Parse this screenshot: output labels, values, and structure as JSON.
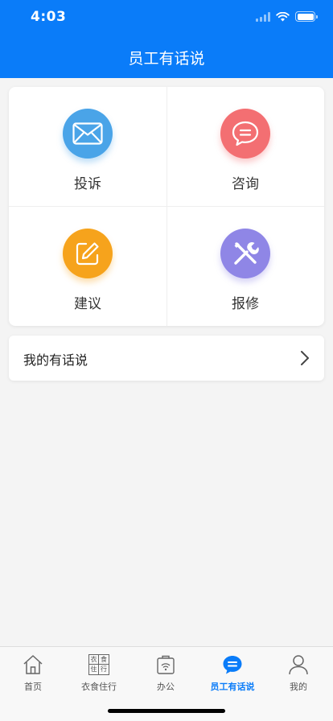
{
  "status_bar": {
    "time": "4:03"
  },
  "header": {
    "title": "员工有话说"
  },
  "grid": {
    "items": [
      {
        "label": "投诉",
        "icon": "envelope-icon",
        "color": "#4aa4e8"
      },
      {
        "label": "咨询",
        "icon": "chat-bubble-icon",
        "color": "#f36f72"
      },
      {
        "label": "建议",
        "icon": "edit-icon",
        "color": "#f6a31c"
      },
      {
        "label": "报修",
        "icon": "tools-icon",
        "color": "#8f86e6"
      }
    ]
  },
  "my_entry": {
    "label": "我的有话说"
  },
  "tabbar": {
    "active_color": "#0a7cf9",
    "items": [
      {
        "label": "首页",
        "icon": "home-icon"
      },
      {
        "label": "衣食住行",
        "icon": "grid-icon",
        "icon_text": [
          "衣",
          "食",
          "住",
          "行"
        ]
      },
      {
        "label": "办公",
        "icon": "office-icon"
      },
      {
        "label": "员工有话说",
        "icon": "chat-icon",
        "active": true
      },
      {
        "label": "我的",
        "icon": "person-icon"
      }
    ]
  }
}
